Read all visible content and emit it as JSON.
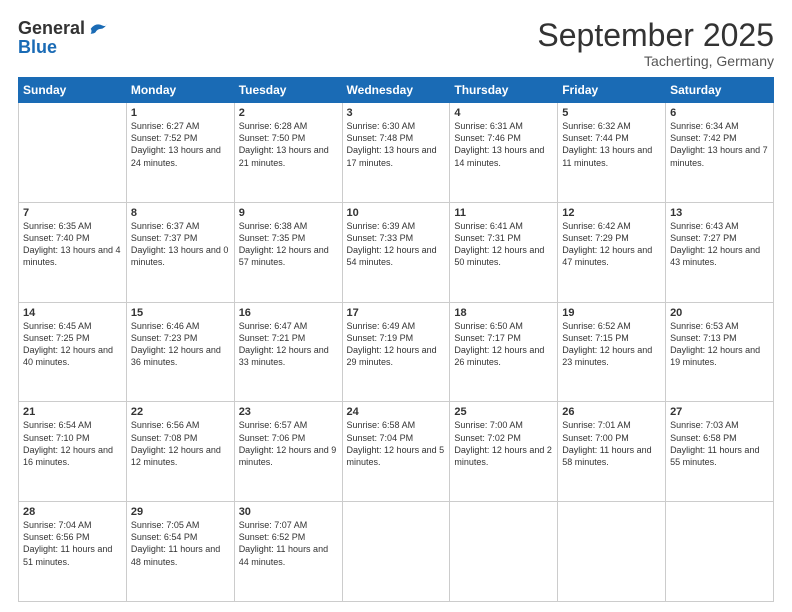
{
  "logo": {
    "general": "General",
    "blue": "Blue"
  },
  "header": {
    "month": "September 2025",
    "location": "Tacherting, Germany"
  },
  "weekdays": [
    "Sunday",
    "Monday",
    "Tuesday",
    "Wednesday",
    "Thursday",
    "Friday",
    "Saturday"
  ],
  "weeks": [
    [
      {
        "day": "",
        "info": ""
      },
      {
        "day": "1",
        "info": "Sunrise: 6:27 AM\nSunset: 7:52 PM\nDaylight: 13 hours and 24 minutes."
      },
      {
        "day": "2",
        "info": "Sunrise: 6:28 AM\nSunset: 7:50 PM\nDaylight: 13 hours and 21 minutes."
      },
      {
        "day": "3",
        "info": "Sunrise: 6:30 AM\nSunset: 7:48 PM\nDaylight: 13 hours and 17 minutes."
      },
      {
        "day": "4",
        "info": "Sunrise: 6:31 AM\nSunset: 7:46 PM\nDaylight: 13 hours and 14 minutes."
      },
      {
        "day": "5",
        "info": "Sunrise: 6:32 AM\nSunset: 7:44 PM\nDaylight: 13 hours and 11 minutes."
      },
      {
        "day": "6",
        "info": "Sunrise: 6:34 AM\nSunset: 7:42 PM\nDaylight: 13 hours and 7 minutes."
      }
    ],
    [
      {
        "day": "7",
        "info": "Sunrise: 6:35 AM\nSunset: 7:40 PM\nDaylight: 13 hours and 4 minutes."
      },
      {
        "day": "8",
        "info": "Sunrise: 6:37 AM\nSunset: 7:37 PM\nDaylight: 13 hours and 0 minutes."
      },
      {
        "day": "9",
        "info": "Sunrise: 6:38 AM\nSunset: 7:35 PM\nDaylight: 12 hours and 57 minutes."
      },
      {
        "day": "10",
        "info": "Sunrise: 6:39 AM\nSunset: 7:33 PM\nDaylight: 12 hours and 54 minutes."
      },
      {
        "day": "11",
        "info": "Sunrise: 6:41 AM\nSunset: 7:31 PM\nDaylight: 12 hours and 50 minutes."
      },
      {
        "day": "12",
        "info": "Sunrise: 6:42 AM\nSunset: 7:29 PM\nDaylight: 12 hours and 47 minutes."
      },
      {
        "day": "13",
        "info": "Sunrise: 6:43 AM\nSunset: 7:27 PM\nDaylight: 12 hours and 43 minutes."
      }
    ],
    [
      {
        "day": "14",
        "info": "Sunrise: 6:45 AM\nSunset: 7:25 PM\nDaylight: 12 hours and 40 minutes."
      },
      {
        "day": "15",
        "info": "Sunrise: 6:46 AM\nSunset: 7:23 PM\nDaylight: 12 hours and 36 minutes."
      },
      {
        "day": "16",
        "info": "Sunrise: 6:47 AM\nSunset: 7:21 PM\nDaylight: 12 hours and 33 minutes."
      },
      {
        "day": "17",
        "info": "Sunrise: 6:49 AM\nSunset: 7:19 PM\nDaylight: 12 hours and 29 minutes."
      },
      {
        "day": "18",
        "info": "Sunrise: 6:50 AM\nSunset: 7:17 PM\nDaylight: 12 hours and 26 minutes."
      },
      {
        "day": "19",
        "info": "Sunrise: 6:52 AM\nSunset: 7:15 PM\nDaylight: 12 hours and 23 minutes."
      },
      {
        "day": "20",
        "info": "Sunrise: 6:53 AM\nSunset: 7:13 PM\nDaylight: 12 hours and 19 minutes."
      }
    ],
    [
      {
        "day": "21",
        "info": "Sunrise: 6:54 AM\nSunset: 7:10 PM\nDaylight: 12 hours and 16 minutes."
      },
      {
        "day": "22",
        "info": "Sunrise: 6:56 AM\nSunset: 7:08 PM\nDaylight: 12 hours and 12 minutes."
      },
      {
        "day": "23",
        "info": "Sunrise: 6:57 AM\nSunset: 7:06 PM\nDaylight: 12 hours and 9 minutes."
      },
      {
        "day": "24",
        "info": "Sunrise: 6:58 AM\nSunset: 7:04 PM\nDaylight: 12 hours and 5 minutes."
      },
      {
        "day": "25",
        "info": "Sunrise: 7:00 AM\nSunset: 7:02 PM\nDaylight: 12 hours and 2 minutes."
      },
      {
        "day": "26",
        "info": "Sunrise: 7:01 AM\nSunset: 7:00 PM\nDaylight: 11 hours and 58 minutes."
      },
      {
        "day": "27",
        "info": "Sunrise: 7:03 AM\nSunset: 6:58 PM\nDaylight: 11 hours and 55 minutes."
      }
    ],
    [
      {
        "day": "28",
        "info": "Sunrise: 7:04 AM\nSunset: 6:56 PM\nDaylight: 11 hours and 51 minutes."
      },
      {
        "day": "29",
        "info": "Sunrise: 7:05 AM\nSunset: 6:54 PM\nDaylight: 11 hours and 48 minutes."
      },
      {
        "day": "30",
        "info": "Sunrise: 7:07 AM\nSunset: 6:52 PM\nDaylight: 11 hours and 44 minutes."
      },
      {
        "day": "",
        "info": ""
      },
      {
        "day": "",
        "info": ""
      },
      {
        "day": "",
        "info": ""
      },
      {
        "day": "",
        "info": ""
      }
    ]
  ]
}
